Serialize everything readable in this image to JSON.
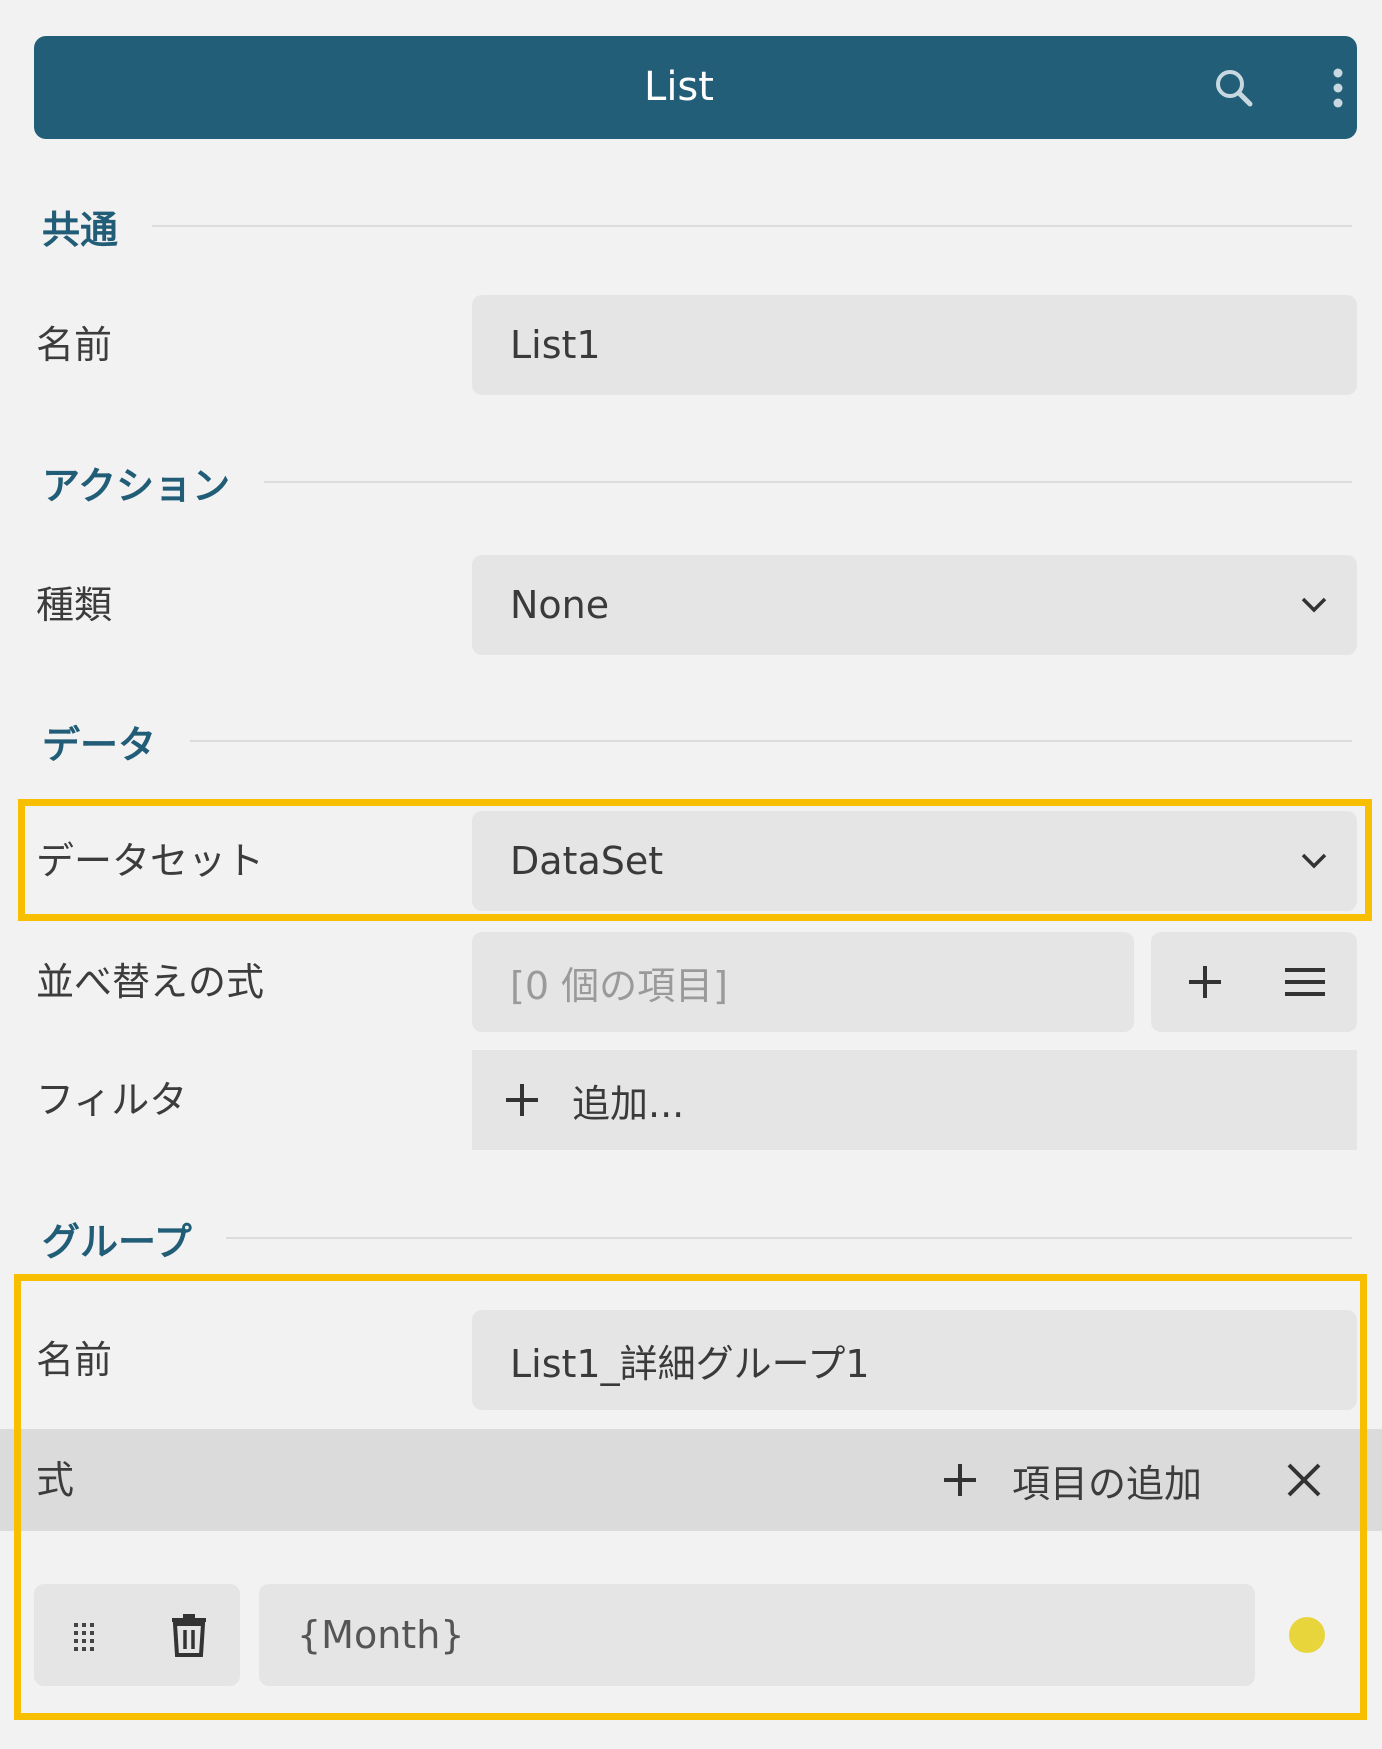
{
  "header": {
    "title": "List",
    "search_icon": "search-icon",
    "menu_icon": "more-vertical-icon",
    "color": "#235e78"
  },
  "sections": {
    "common": "共通",
    "action": "アクション",
    "data": "データ",
    "group": "グループ"
  },
  "common": {
    "name_label": "名前",
    "name_value": "List1"
  },
  "action": {
    "type_label": "種類",
    "type_value": "None"
  },
  "data": {
    "dataset_label": "データセット",
    "dataset_value": "DataSet",
    "sort_label": "並べ替えの式",
    "sort_placeholder": "[0 個の項目]",
    "filter_label": "フィルタ",
    "filter_add": "追加..."
  },
  "group": {
    "name_label": "名前",
    "name_value": "List1_詳細グループ1",
    "expr_label": "式",
    "add_item": "項目の追加",
    "expr_value": "{Month}",
    "status_color": "#e8d53c"
  },
  "highlight_color": "#f8bf00"
}
